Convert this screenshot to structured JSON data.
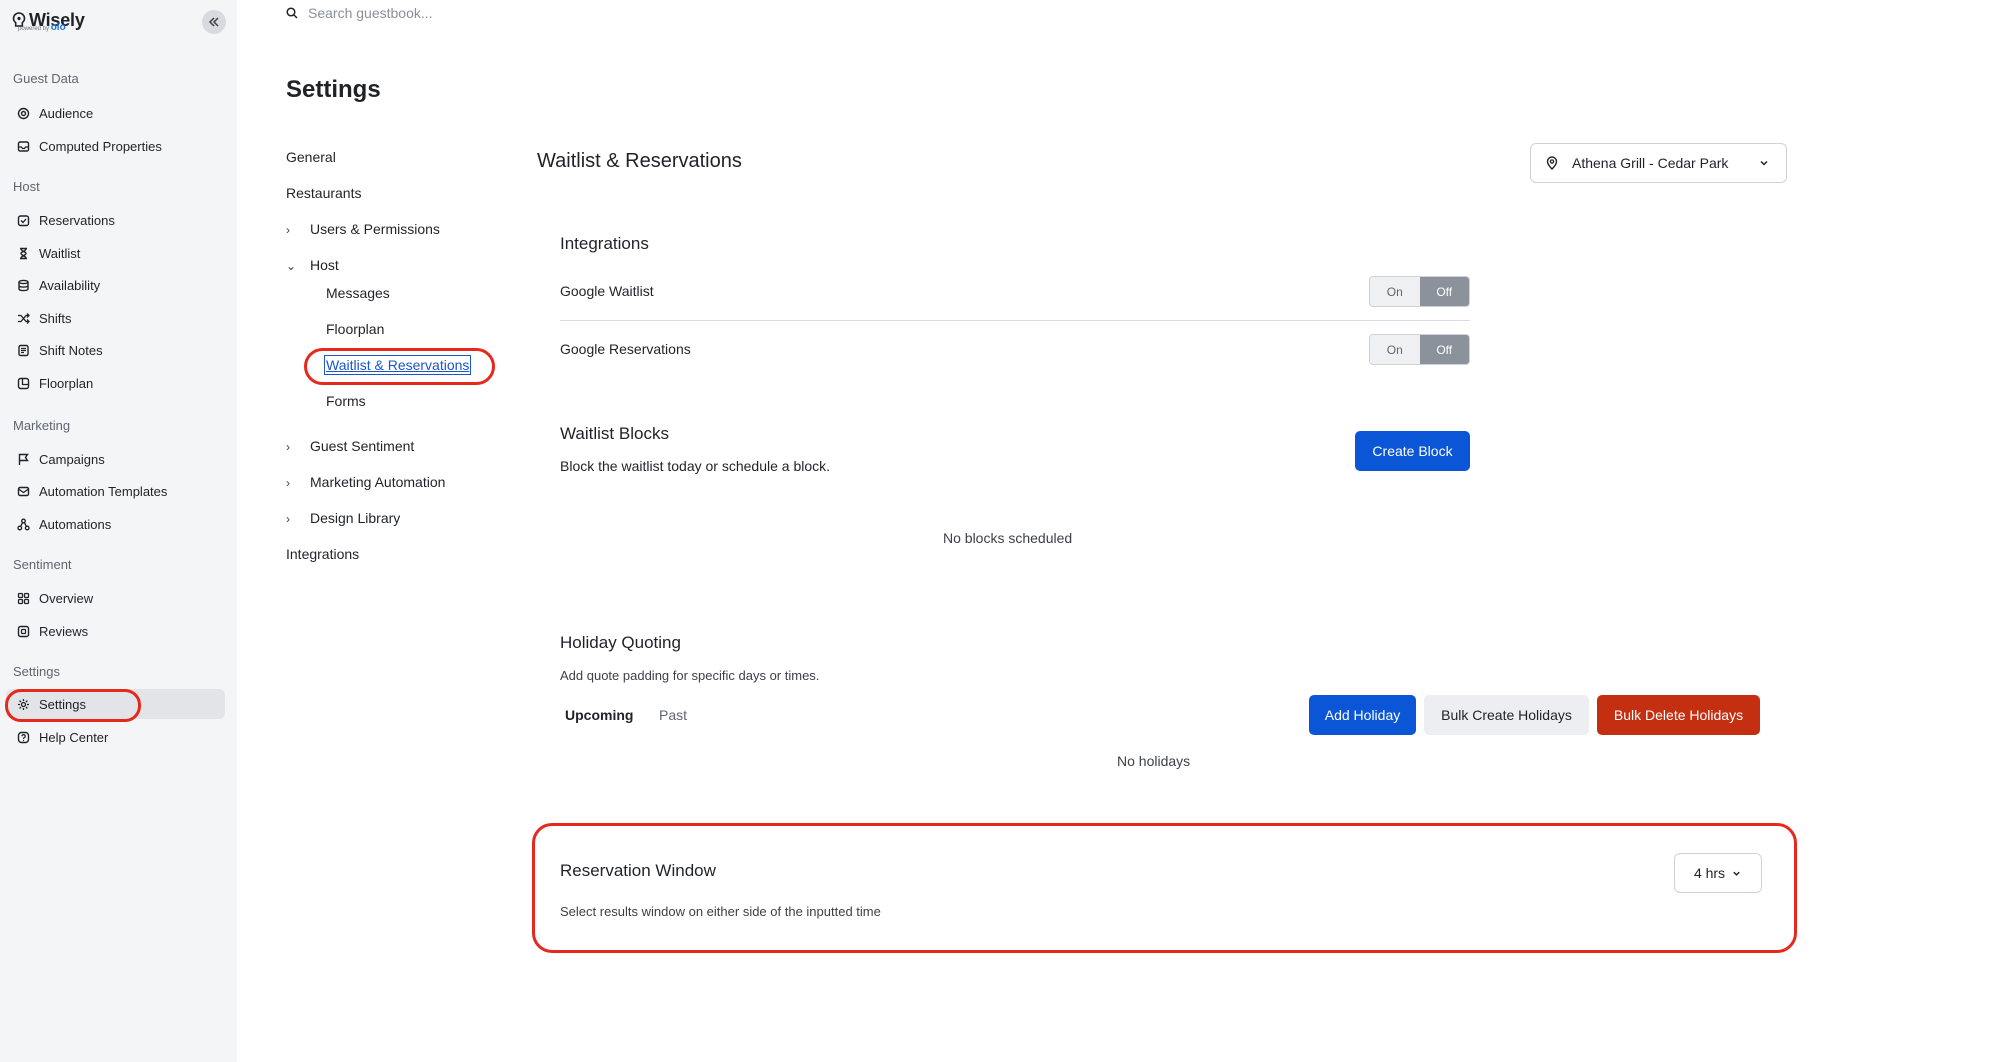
{
  "brand": {
    "name": "Wisely",
    "powered_by": "powered by",
    "parent": "olo"
  },
  "search": {
    "placeholder": "Search guestbook..."
  },
  "sidebar": {
    "sections": [
      {
        "label": "Guest Data",
        "items": [
          {
            "label": "Audience",
            "icon": "target-icon"
          },
          {
            "label": "Computed Properties",
            "icon": "inbox-icon"
          }
        ]
      },
      {
        "label": "Host",
        "items": [
          {
            "label": "Reservations",
            "icon": "calendar-icon"
          },
          {
            "label": "Waitlist",
            "icon": "hourglass-icon"
          },
          {
            "label": "Availability",
            "icon": "database-icon"
          },
          {
            "label": "Shifts",
            "icon": "shuffle-icon"
          },
          {
            "label": "Shift Notes",
            "icon": "notes-icon"
          },
          {
            "label": "Floorplan",
            "icon": "floorplan-icon"
          }
        ]
      },
      {
        "label": "Marketing",
        "items": [
          {
            "label": "Campaigns",
            "icon": "flag-icon"
          },
          {
            "label": "Automation Templates",
            "icon": "mail-icon"
          },
          {
            "label": "Automations",
            "icon": "automation-icon"
          }
        ]
      },
      {
        "label": "Sentiment",
        "items": [
          {
            "label": "Overview",
            "icon": "grid-icon"
          },
          {
            "label": "Reviews",
            "icon": "reviews-icon"
          }
        ]
      },
      {
        "label": "Settings",
        "items": [
          {
            "label": "Settings",
            "icon": "gear-icon",
            "active": true
          },
          {
            "label": "Help Center",
            "icon": "help-icon"
          }
        ]
      }
    ]
  },
  "page": {
    "title": "Settings"
  },
  "settings_nav": {
    "general": "General",
    "restaurants": "Restaurants",
    "users_permissions": "Users & Permissions",
    "host": "Host",
    "messages": "Messages",
    "floorplan": "Floorplan",
    "waitlist_reservations": "Waitlist & Reservations",
    "forms": "Forms",
    "guest_sentiment": "Guest Sentiment",
    "marketing_automation": "Marketing Automation",
    "design_library": "Design Library",
    "integrations": "Integrations"
  },
  "content": {
    "title": "Waitlist & Reservations",
    "location": "Athena Grill - Cedar Park",
    "integrations": {
      "heading": "Integrations",
      "rows": [
        {
          "label": "Google Waitlist",
          "on": "On",
          "off": "Off",
          "state": "Off"
        },
        {
          "label": "Google Reservations",
          "on": "On",
          "off": "Off",
          "state": "Off"
        }
      ]
    },
    "waitlist_blocks": {
      "heading": "Waitlist Blocks",
      "description": "Block the waitlist today or schedule a block.",
      "create_button": "Create Block",
      "empty": "No blocks scheduled"
    },
    "holiday_quoting": {
      "heading": "Holiday Quoting",
      "description": "Add quote padding for specific days or times.",
      "tabs": [
        "Upcoming",
        "Past"
      ],
      "active_tab": "Upcoming",
      "add_button": "Add Holiday",
      "bulk_create_button": "Bulk Create Holidays",
      "bulk_delete_button": "Bulk Delete Holidays",
      "empty": "No holidays"
    },
    "reservation_window": {
      "heading": "Reservation Window",
      "description": "Select results window on either side of the inputted time",
      "value": "4 hrs"
    }
  },
  "colors": {
    "primary": "#0a56d6",
    "danger": "#c42f12",
    "highlight": "#e5291c",
    "sidebar_bg": "#f4f5f7"
  }
}
